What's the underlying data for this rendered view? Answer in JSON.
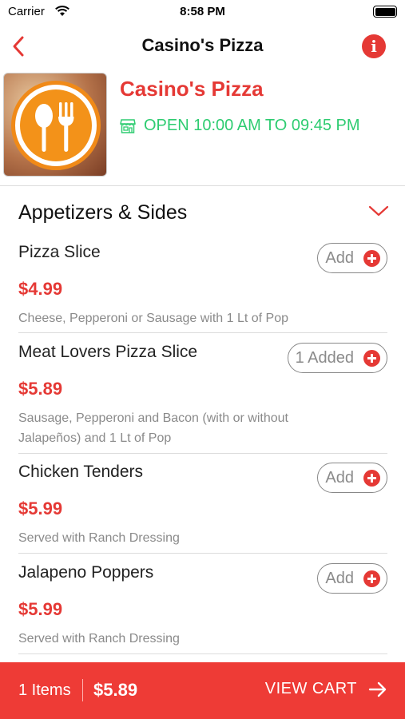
{
  "status_bar": {
    "carrier": "Carrier",
    "time": "8:58 PM"
  },
  "nav": {
    "title": "Casino's Pizza"
  },
  "restaurant": {
    "name": "Casino's Pizza",
    "hours": "OPEN 10:00 AM TO 09:45 PM"
  },
  "category": {
    "title": "Appetizers & Sides"
  },
  "items": [
    {
      "name": "Pizza Slice",
      "price": "$4.99",
      "description": "Cheese, Pepperoni or Sausage with 1 Lt of Pop",
      "button": "Add"
    },
    {
      "name": "Meat Lovers Pizza Slice",
      "price": "$5.89",
      "description": "Sausage, Pepperoni and Bacon (with or without Jalapeños) and 1 Lt of Pop",
      "button": "1 Added"
    },
    {
      "name": "Chicken Tenders",
      "price": "$5.99",
      "description": "Served with Ranch Dressing",
      "button": "Add"
    },
    {
      "name": "Jalapeno Poppers",
      "price": "$5.99",
      "description": "Served with Ranch Dressing",
      "button": "Add"
    }
  ],
  "cart": {
    "count": "1 Items",
    "total": "$5.89",
    "label": "VIEW CART"
  },
  "colors": {
    "accent": "#e53935",
    "open": "#2ecc71",
    "cart_bar": "#ee3b36"
  }
}
